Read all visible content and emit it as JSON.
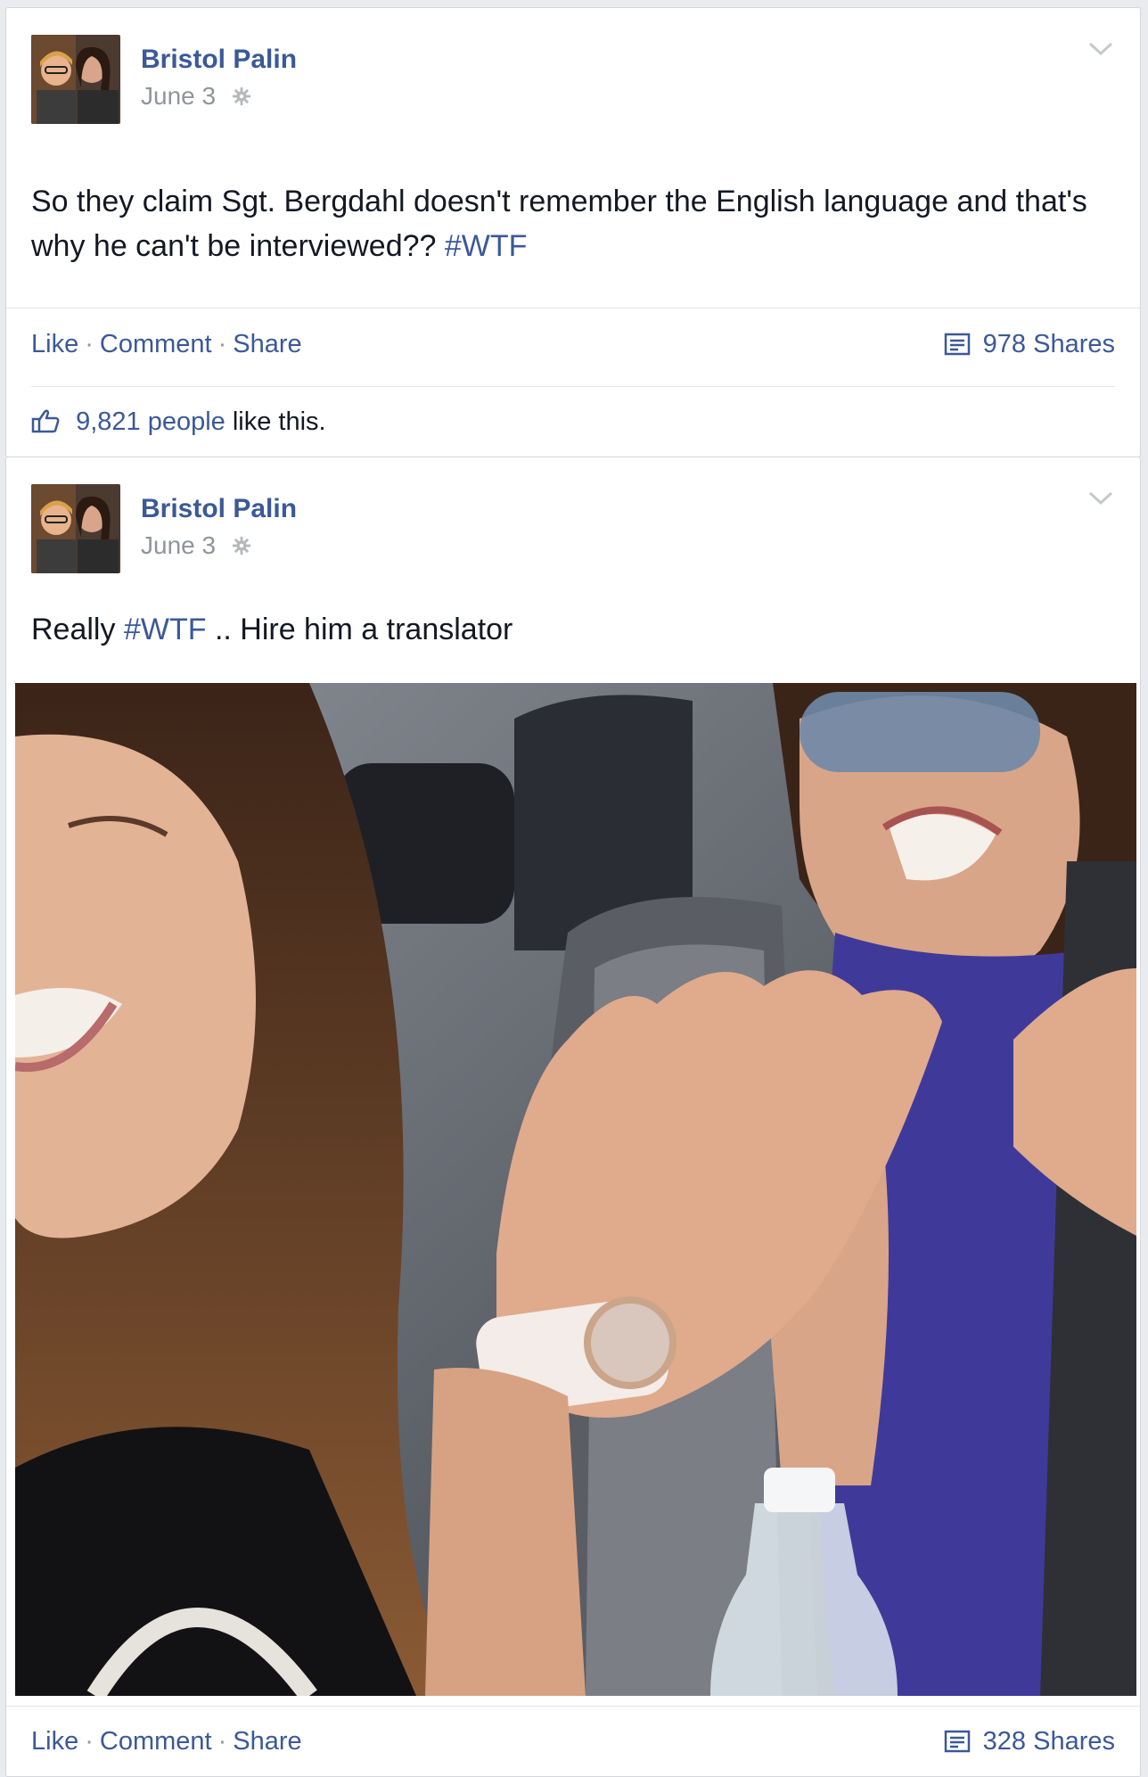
{
  "posts": [
    {
      "author": "Bristol Palin",
      "date": "June 3",
      "text": "So they claim Sgt. Bergdahl doesn't remember the English language and that's why he can't be interviewed??",
      "hashtag": "#WTF",
      "text_after": "",
      "actions": {
        "like": "Like",
        "comment": "Comment",
        "share": "Share"
      },
      "shares": "978 Shares",
      "likes": {
        "count": "9,821",
        "people": "people",
        "suffix": "like this."
      }
    },
    {
      "author": "Bristol Palin",
      "date": "June 3",
      "text": "Really",
      "hashtag": "#WTF",
      "text_after": ".. Hire him a translator",
      "actions": {
        "like": "Like",
        "comment": "Comment",
        "share": "Share"
      },
      "shares": "328 Shares"
    }
  ],
  "icons": {
    "avatar": "avatar",
    "gear": "gear-icon",
    "chevron": "chevron-down-icon",
    "shares": "shares-icon",
    "like": "thumbs-up-icon"
  },
  "colors": {
    "link": "#3b5998",
    "meta": "#90949c",
    "text": "#141823"
  }
}
